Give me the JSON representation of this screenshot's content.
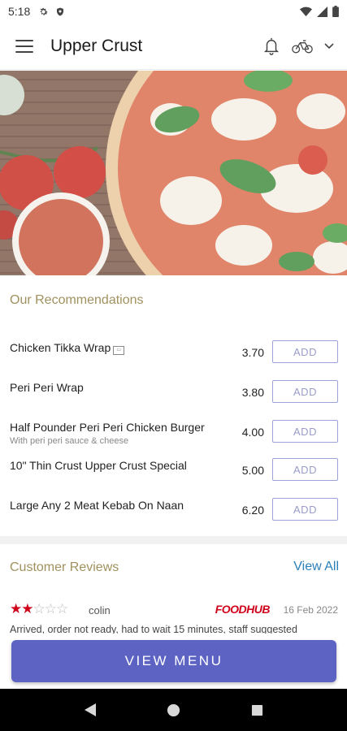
{
  "status_bar": {
    "time": "5:18"
  },
  "app_bar": {
    "title": "Upper Crust"
  },
  "recommendations": {
    "title": "Our Recommendations",
    "items": [
      {
        "name": "Chicken Tikka Wrap",
        "subtitle": "",
        "price": "3.70",
        "button": "ADD"
      },
      {
        "name": "Peri Peri Wrap",
        "subtitle": "",
        "price": "3.80",
        "button": "ADD"
      },
      {
        "name": "Half Pounder Peri Peri Chicken Burger",
        "subtitle": "With peri peri sauce & cheese",
        "price": "4.00",
        "button": "ADD"
      },
      {
        "name": "10\" Thin Crust Upper Crust Special",
        "subtitle": "",
        "price": "5.00",
        "button": "ADD"
      },
      {
        "name": "Large Any 2 Meat Kebab On Naan",
        "subtitle": "",
        "price": "6.20",
        "button": "ADD"
      }
    ]
  },
  "reviews": {
    "title": "Customer Reviews",
    "view_all": "View All",
    "items": [
      {
        "rating": 2,
        "max_rating": 5,
        "author": "colin",
        "source": "FOODHUB",
        "date": "16 Feb 2022",
        "text": "Arrived, order not ready, had to wait 15 minutes, staff suggested"
      }
    ]
  },
  "cta": {
    "label": "VIEW MENU"
  },
  "colors": {
    "accent": "#5c63c2",
    "section_title": "#a0915e",
    "link": "#2c7fb8",
    "star": "#d0021b",
    "brand_foodhub": "#d0021b"
  },
  "icons": {
    "status_left": [
      "settings-icon",
      "shield-icon"
    ],
    "status_right": [
      "wifi-icon",
      "signal-icon",
      "battery-icon"
    ],
    "app_bar": [
      "menu-icon",
      "bell-icon",
      "bike-icon",
      "chevron-down-icon"
    ],
    "nav": [
      "back-icon",
      "home-icon",
      "recents-icon"
    ]
  }
}
